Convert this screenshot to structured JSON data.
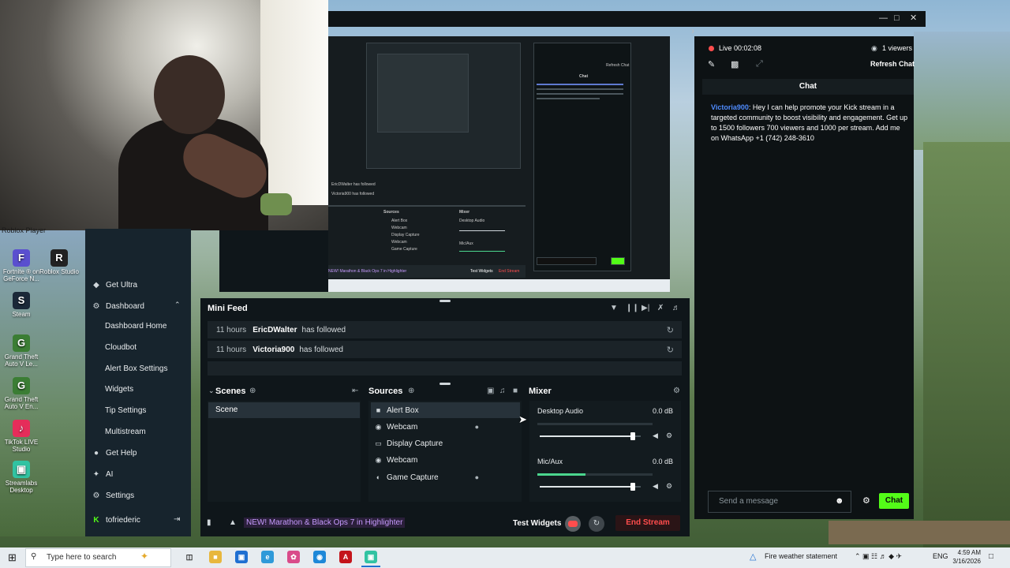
{
  "webcam": {
    "overlay_label": "Roblox Player"
  },
  "desktop_icons": [
    {
      "label": "Fortnite ® on GeForce N...",
      "icon": "fortnite-icon",
      "color": "#5a4fcf"
    },
    {
      "label": "Roblox Studio",
      "icon": "roblox-studio-icon",
      "color": "#222222"
    },
    {
      "label": "Steam",
      "icon": "steam-icon",
      "color": "#1b2838"
    },
    {
      "label": "Grand Theft Auto V Le...",
      "icon": "gta-icon",
      "color": "#3b7d34"
    },
    {
      "label": "Grand Theft Auto V En...",
      "icon": "gta-icon",
      "color": "#3b7d34"
    },
    {
      "label": "TikTok LIVE Studio",
      "icon": "tiktok-icon",
      "color": "#e52d5a"
    },
    {
      "label": "Streamlabs Desktop",
      "icon": "streamlabs-icon",
      "color": "#31c3a2"
    }
  ],
  "sidebar": {
    "items": [
      {
        "label": "Get Ultra",
        "icon": "ultra-icon"
      },
      {
        "label": "Dashboard",
        "icon": "dashboard-icon"
      },
      {
        "label": "Get Help",
        "icon": "help-icon"
      },
      {
        "label": "AI",
        "icon": "ai-icon"
      },
      {
        "label": "Settings",
        "icon": "gear-icon"
      }
    ],
    "subitems": [
      "Dashboard Home",
      "Cloudbot",
      "Alert Box Settings",
      "Widgets",
      "Tip Settings",
      "Multistream"
    ],
    "user": "tofriederic"
  },
  "minifeed": {
    "title": "Mini Feed",
    "events": [
      {
        "time": "11 hours",
        "user": "EricDWalter",
        "action": "has followed"
      },
      {
        "time": "11 hours",
        "user": "Victoria900",
        "action": "has followed"
      }
    ]
  },
  "scenes": {
    "title": "Scenes",
    "items": [
      "Scene"
    ]
  },
  "sources": {
    "title": "Sources",
    "items": [
      {
        "label": "Alert Box",
        "icon": "alert-box-icon",
        "locked": false
      },
      {
        "label": "Webcam",
        "icon": "webcam-icon",
        "locked": true
      },
      {
        "label": "Display Capture",
        "icon": "monitor-icon",
        "locked": false
      },
      {
        "label": "Webcam",
        "icon": "webcam-icon",
        "locked": false
      },
      {
        "label": "Game Capture",
        "icon": "gamepad-icon",
        "locked": true
      }
    ]
  },
  "mixer": {
    "title": "Mixer",
    "channels": [
      {
        "name": "Desktop Audio",
        "db": "0.0 dB",
        "level": 0.0,
        "volume": 0.92
      },
      {
        "name": "Mic/Aux",
        "db": "0.0 dB",
        "level": 0.42,
        "volume": 0.92
      }
    ]
  },
  "bottombar": {
    "promo": "NEW! Marathon & Black Ops 7 in Highlighter",
    "test_widgets": "Test Widgets",
    "end_stream": "End Stream"
  },
  "chat": {
    "live_time": "Live 00:02:08",
    "viewers": "1 viewers",
    "refresh": "Refresh Chat",
    "title": "Chat",
    "message_user": "Victoria900",
    "message_text": ": Hey I can help promote your Kick stream in a targeted community to boost visibility and engagement. Get up to 1500 followers 700 viewers and 1000 per stream. Add me on WhatsApp +1 (742) 248-3610",
    "input_placeholder": "Send a message",
    "send_label": "Chat",
    "accent_color": "#53fc18"
  },
  "taskbar": {
    "search_placeholder": "Type here to search",
    "weather": "Fire weather statement",
    "language": "ENG",
    "time": "4:59 AM",
    "date": "3/16/2026"
  },
  "preview_nested": {
    "line1": "EricDWalter has followed",
    "line2": "Victoria900 has followed",
    "sources": "Sources",
    "mixer": "Mixer",
    "items": [
      "Alert Box",
      "Webcam",
      "Display Capture",
      "Webcam",
      "Game Capture"
    ],
    "desktop_audio": "Desktop Audio",
    "mic_aux": "Mic/Aux",
    "chat_title": "Chat",
    "test_widgets": "Test Widgets",
    "end_stream": "End Stream",
    "promo": "NEW! Marathon & Black Ops 7 in Highlighter",
    "refresh": "Refresh Chat"
  }
}
